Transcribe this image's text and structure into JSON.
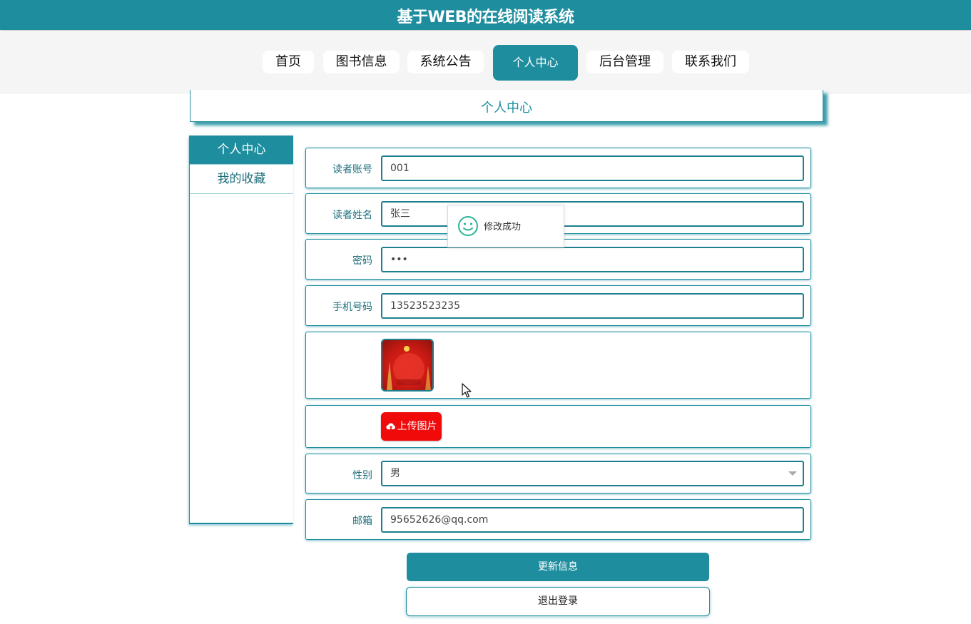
{
  "header": {
    "title": "基于WEB的在线阅读系统"
  },
  "nav": {
    "items": [
      {
        "label": "首页"
      },
      {
        "label": "图书信息"
      },
      {
        "label": "系统公告"
      },
      {
        "label": "个人中心"
      },
      {
        "label": "后台管理"
      },
      {
        "label": "联系我们"
      }
    ],
    "active": "个人中心"
  },
  "section": {
    "title": "个人中心"
  },
  "sidebar": {
    "items": [
      {
        "label": "个人中心"
      },
      {
        "label": "我的收藏"
      }
    ]
  },
  "form": {
    "account": {
      "label": "读者账号",
      "value": "001"
    },
    "name": {
      "label": "读者姓名",
      "value": "张三"
    },
    "password": {
      "label": "密码",
      "value": "•••"
    },
    "phone": {
      "label": "手机号码",
      "value": "13523523235"
    },
    "upload_label": "上传图片",
    "gender": {
      "label": "性别",
      "value": "男"
    },
    "email": {
      "label": "邮箱",
      "value": "95652626@qq.com"
    }
  },
  "actions": {
    "update_label": "更新信息",
    "logout_label": "退出登录"
  },
  "toast": {
    "message": "修改成功"
  },
  "colors": {
    "primary": "#1e8e9f",
    "upload": "#f00a0a",
    "toast_icon": "#2bb59a"
  },
  "icons": {
    "toast": "smile-icon",
    "upload": "cloud-upload-icon",
    "select": "chevron-down-icon"
  }
}
